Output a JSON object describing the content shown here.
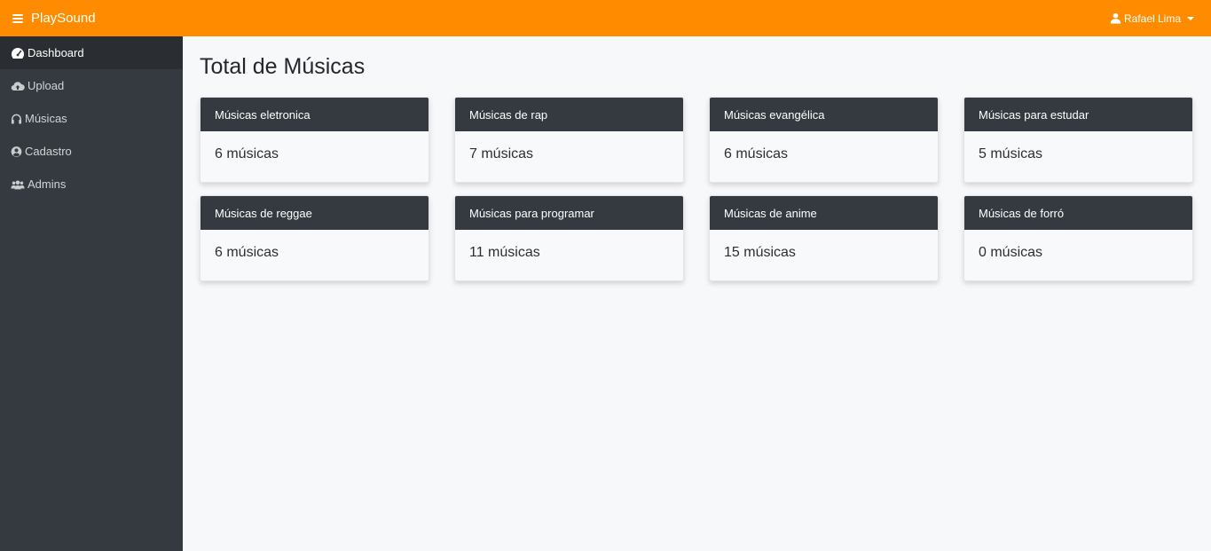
{
  "topbar": {
    "brand": "PlaySound",
    "user_name": "Rafael Lima",
    "color": "#ff8c00"
  },
  "sidebar": {
    "items": [
      {
        "label": "Dashboard",
        "icon": "dashboard-icon",
        "active": true
      },
      {
        "label": "Upload",
        "icon": "cloud-upload-icon",
        "active": false
      },
      {
        "label": "Músicas",
        "icon": "headphones-icon",
        "active": false
      },
      {
        "label": "Cadastro",
        "icon": "user-circle-icon",
        "active": false
      },
      {
        "label": "Admins",
        "icon": "users-icon",
        "active": false
      }
    ]
  },
  "main": {
    "title": "Total de Músicas",
    "cards": [
      {
        "header": "Músicas eletronica",
        "count": "6 músicas"
      },
      {
        "header": "Músicas de rap",
        "count": "7 músicas"
      },
      {
        "header": "Músicas evangélica",
        "count": "6 músicas"
      },
      {
        "header": "Músicas para estudar",
        "count": "5 músicas"
      },
      {
        "header": "Músicas de reggae",
        "count": "6 músicas"
      },
      {
        "header": "Músicas para programar",
        "count": "11 músicas"
      },
      {
        "header": "Músicas de anime",
        "count": "15 músicas"
      },
      {
        "header": "Músicas de forró",
        "count": "0 músicas"
      }
    ]
  }
}
